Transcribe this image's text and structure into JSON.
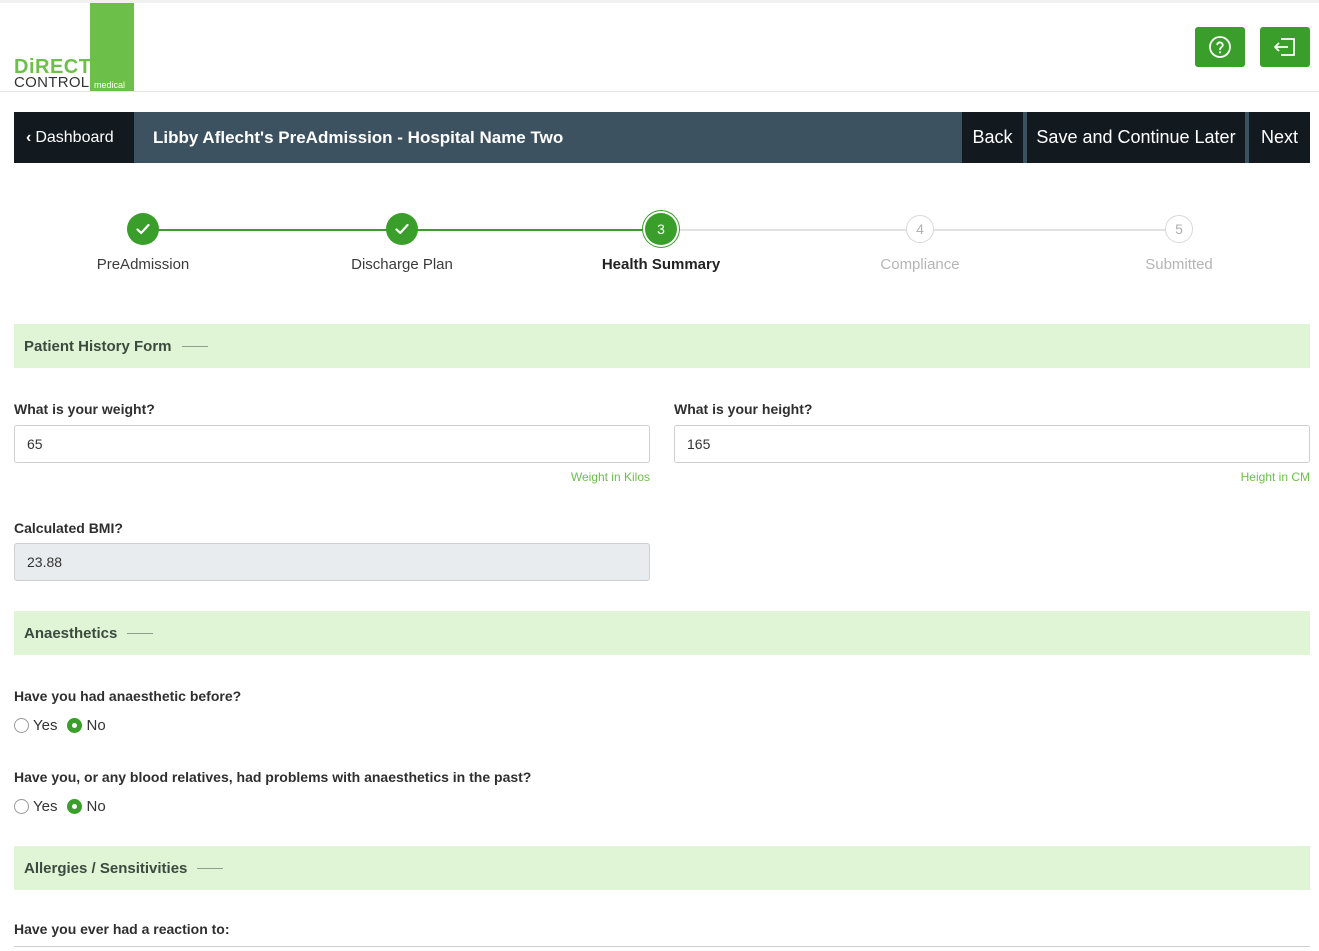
{
  "brand": {
    "logo_direct": "DiRECT",
    "logo_control": "CONTROL",
    "logo_medical": "medical",
    "accent_color": "#6cc04a",
    "button_color": "#3a9e2a"
  },
  "header": {
    "help_icon": "question-circle-icon",
    "logout_icon": "sign-out-icon"
  },
  "titlebar": {
    "dashboard_label": "Dashboard",
    "title": "Libby Aflecht's PreAdmission - Hospital Name Two",
    "back_label": "Back",
    "save_label": "Save and Continue Later",
    "next_label": "Next"
  },
  "stepper": {
    "steps": [
      {
        "number": "1",
        "label": "PreAdmission",
        "state": "done"
      },
      {
        "number": "2",
        "label": "Discharge Plan",
        "state": "done"
      },
      {
        "number": "3",
        "label": "Health Summary",
        "state": "current"
      },
      {
        "number": "4",
        "label": "Compliance",
        "state": "todo"
      },
      {
        "number": "5",
        "label": "Submitted",
        "state": "todo"
      }
    ]
  },
  "sections": {
    "patient_history": "Patient History Form",
    "anaesthetics": "Anaesthetics",
    "allergies": "Allergies / Sensitivities"
  },
  "form": {
    "weight_label": "What is your weight?",
    "weight_value": "65",
    "weight_hint": "Weight in Kilos",
    "height_label": "What is your height?",
    "height_value": "165",
    "height_hint": "Height in CM",
    "bmi_label": "Calculated BMI?",
    "bmi_value": "23.88",
    "anaesthetic_before_label": "Have you had anaesthetic before?",
    "anaesthetic_before_yes": "Yes",
    "anaesthetic_before_no": "No",
    "anaesthetic_before_selected": "No",
    "anaesthetic_problems_label": "Have you, or any blood relatives, had problems with anaesthetics in the past?",
    "anaesthetic_problems_yes": "Yes",
    "anaesthetic_problems_no": "No",
    "anaesthetic_problems_selected": "No",
    "reaction_label": "Have you ever had a reaction to:"
  }
}
